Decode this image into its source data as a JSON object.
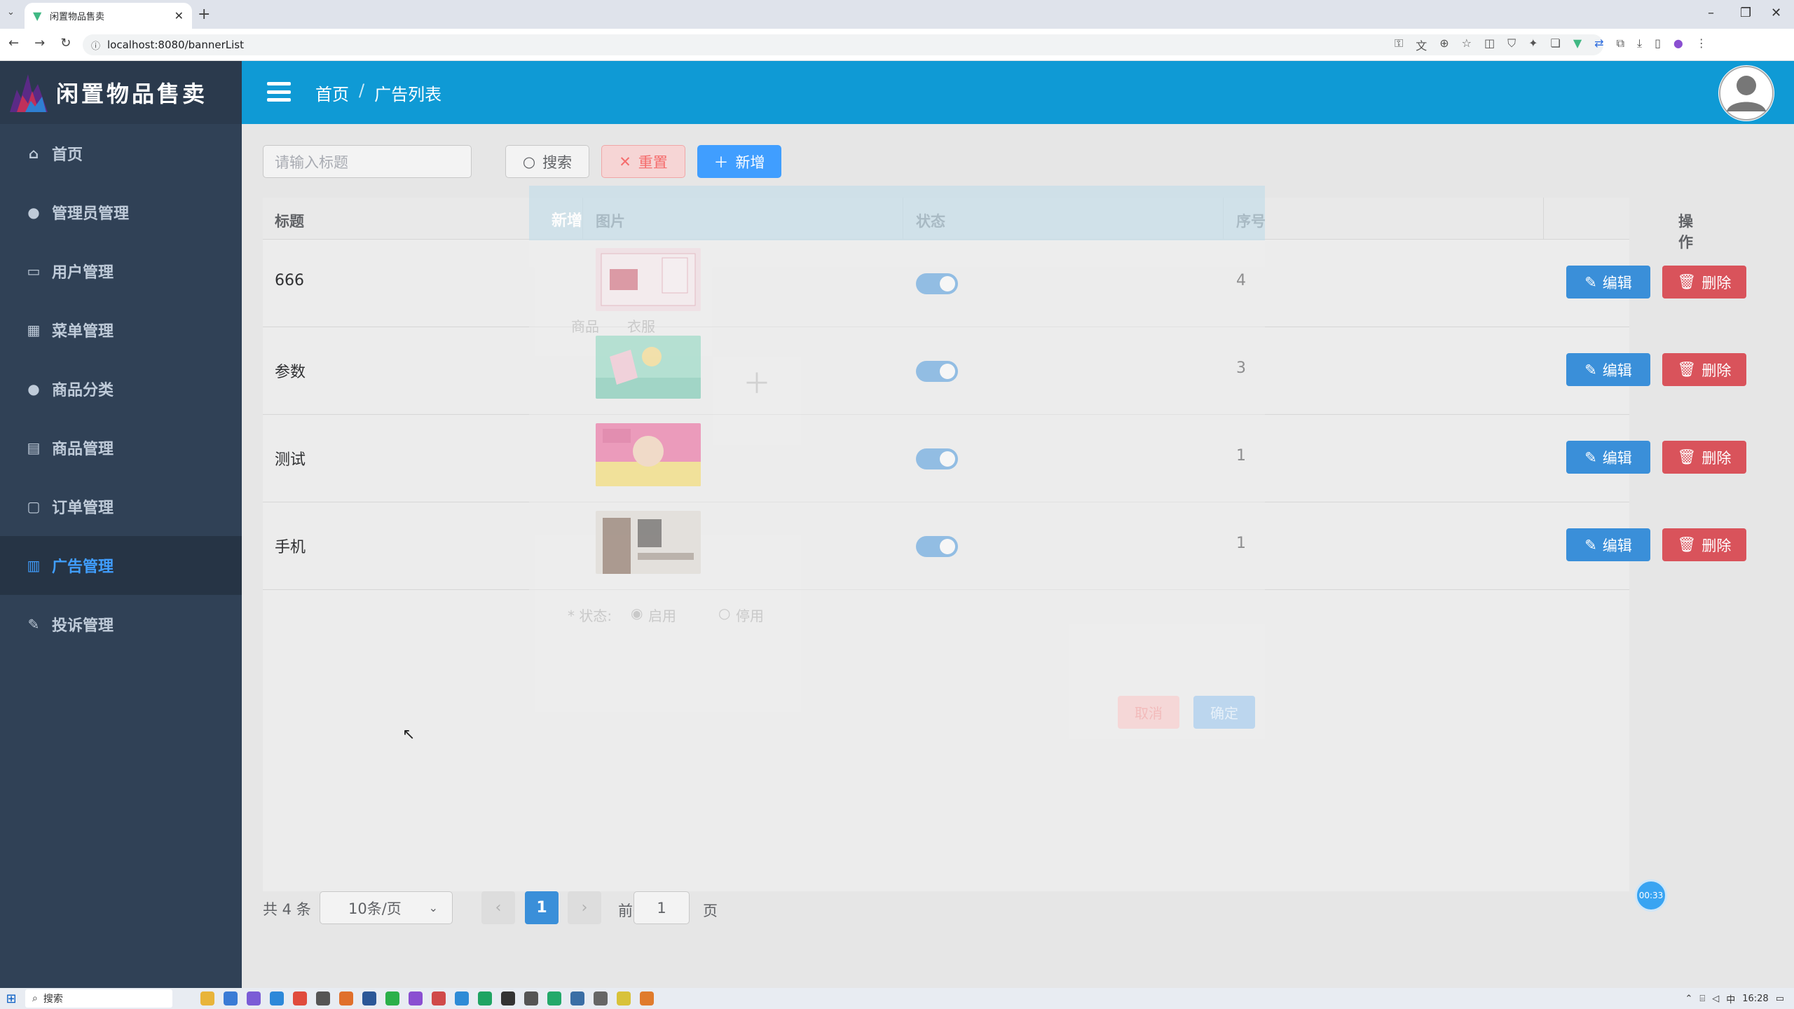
{
  "browser": {
    "tab_title": "闲置物品售卖",
    "url": "localhost:8080/bannerList",
    "new_tab": "+",
    "tab_close": "✕"
  },
  "app": {
    "name": "闲置物品售卖",
    "breadcrumb": [
      "首页",
      "/",
      "广告列表"
    ]
  },
  "sidebar": {
    "items": [
      {
        "label": "首页",
        "icon": "home-icon"
      },
      {
        "label": "管理员管理",
        "icon": "user-icon"
      },
      {
        "label": "用户管理",
        "icon": "wallet-icon"
      },
      {
        "label": "菜单管理",
        "icon": "grid-icon"
      },
      {
        "label": "商品分类",
        "icon": "user-icon"
      },
      {
        "label": "商品管理",
        "icon": "document-icon"
      },
      {
        "label": "订单管理",
        "icon": "monitor-icon"
      },
      {
        "label": "广告管理",
        "icon": "calendar-icon"
      },
      {
        "label": "投诉管理",
        "icon": "edit-icon"
      }
    ],
    "active_index": 7
  },
  "toolbar": {
    "search_placeholder": "请输入标题",
    "search_label": "搜索",
    "reset_label": "重置",
    "add_label": "新增"
  },
  "table": {
    "headers": [
      "标题",
      "图片",
      "状态",
      "序号",
      "操作"
    ],
    "rows": [
      {
        "title": "666",
        "status_on": true,
        "seq": "4"
      },
      {
        "title": "参数",
        "status_on": true,
        "seq": "3"
      },
      {
        "title": "测试",
        "status_on": true,
        "seq": "1"
      },
      {
        "title": "手机",
        "status_on": true,
        "seq": "1"
      }
    ],
    "edit_label": "编辑",
    "delete_label": "删除"
  },
  "dialog": {
    "title": "新增",
    "cancel": "取消",
    "confirm": "确定",
    "status_label": "* 状态:",
    "status_options": [
      "启用",
      "停用"
    ],
    "goods_label": "商品",
    "goods_value": "衣服"
  },
  "pagination": {
    "total": "共 4 条",
    "page_size": "10条/页",
    "current_page": "1",
    "goto_prefix": "前往",
    "goto_value": "1",
    "goto_suffix": "页"
  },
  "recorder": {
    "time": "00:33"
  },
  "taskbar": {
    "search": "搜索",
    "time": "16:28",
    "ime": "中"
  },
  "colors": {
    "sidebar_bg": "#304156",
    "topbar_bg": "#0f9ad5",
    "primary": "#409eff",
    "danger": "#d9535b"
  }
}
